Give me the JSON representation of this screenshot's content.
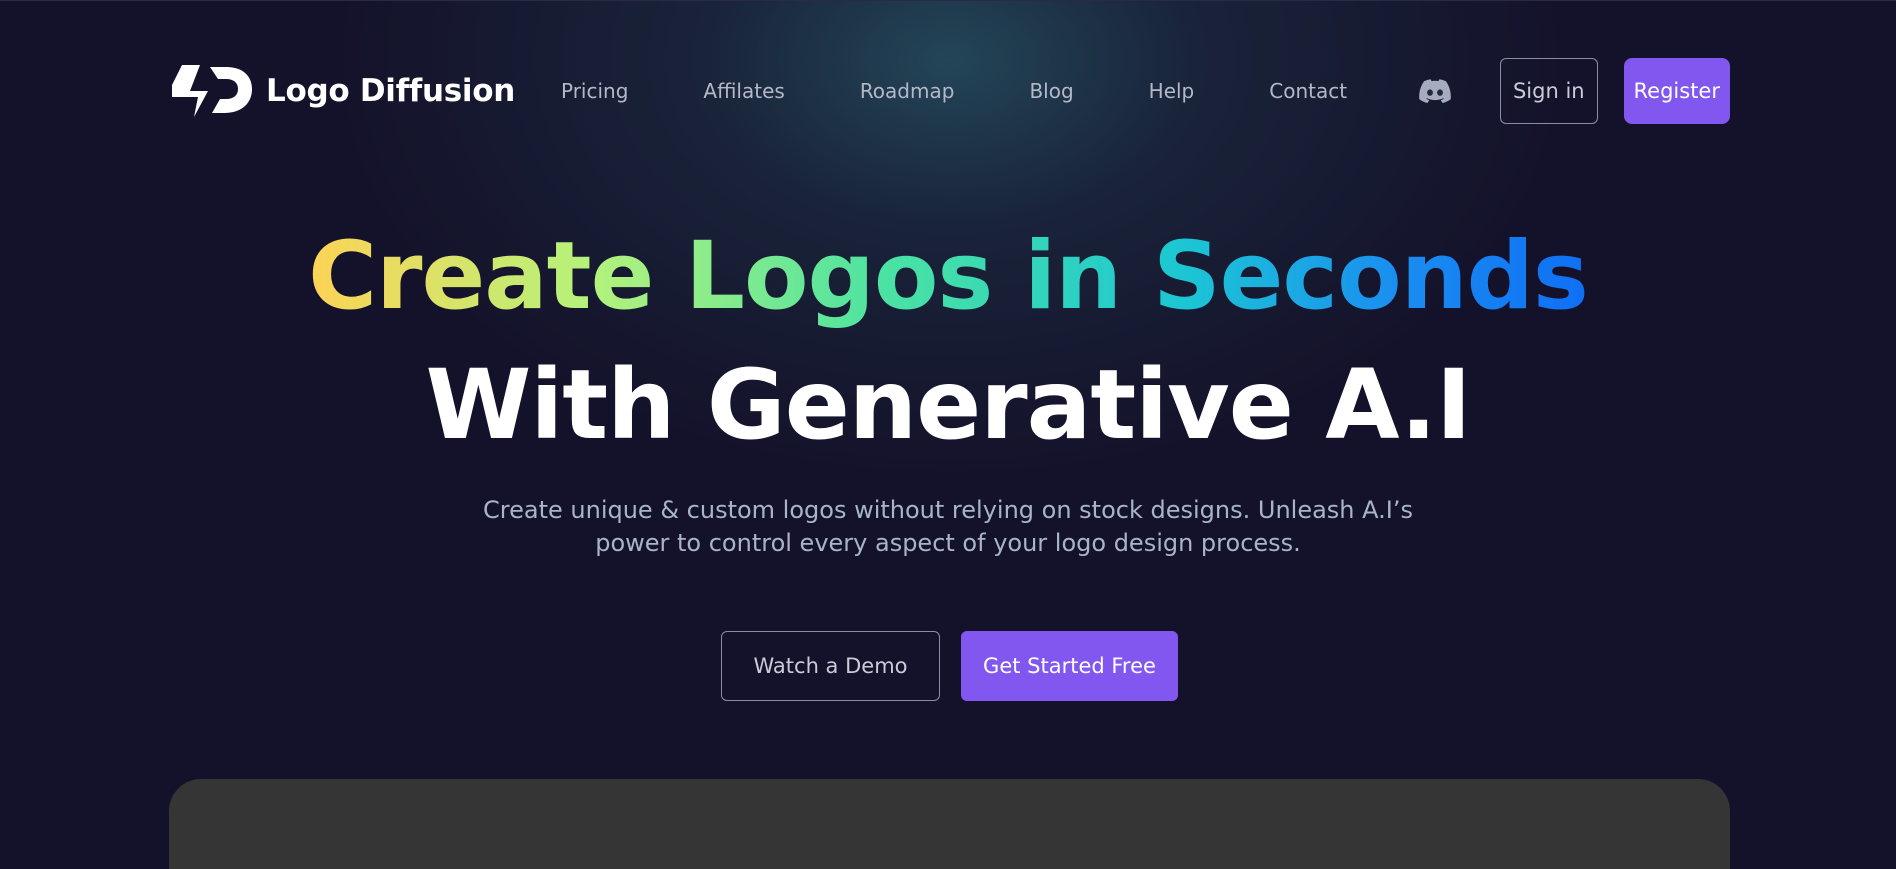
{
  "brand": {
    "name": "Logo Diffusion",
    "logo_icon": "logo-diffusion-mark"
  },
  "nav": {
    "links": [
      "Pricing",
      "Affilates",
      "Roadmap",
      "Blog",
      "Help",
      "Contact"
    ],
    "discord_icon": "discord-icon",
    "signin_label": "Sign in",
    "register_label": "Register"
  },
  "hero": {
    "title_line1": "Create Logos in Seconds",
    "title_line2": "With Generative A.I",
    "subtitle_line1": "Create unique & custom logos without relying on stock designs. Unleash A.I’s",
    "subtitle_line2": "power to control every aspect of your logo design process.",
    "demo_label": "Watch a Demo",
    "start_label": "Get Started Free"
  },
  "colors": {
    "background": "#14122a",
    "accent": "#8257f0",
    "preview_panel": "#353535"
  }
}
